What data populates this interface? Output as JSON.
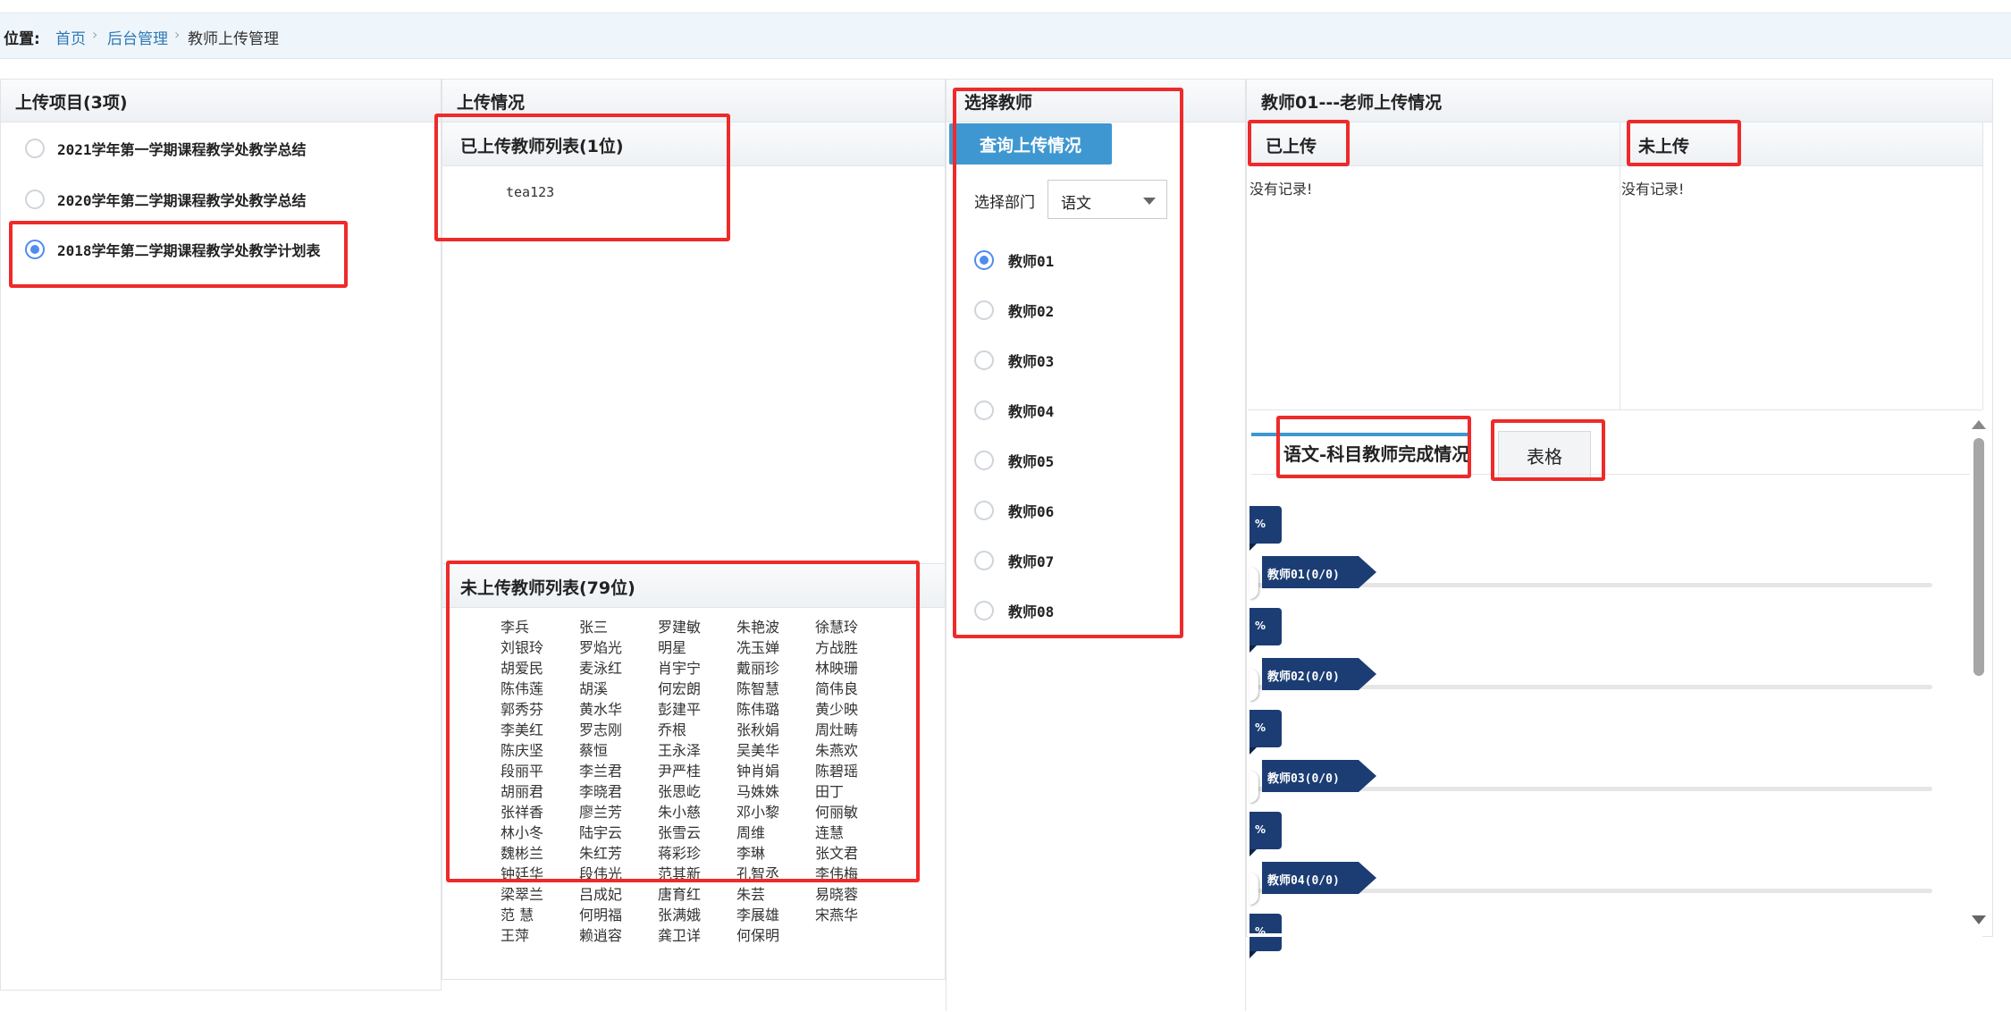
{
  "breadcrumb": {
    "label": "位置:",
    "items": [
      "首页",
      "后台管理",
      "教师上传管理"
    ],
    "separator": "›"
  },
  "projects": {
    "title": "上传项目(3项)",
    "items": [
      {
        "label": "2021学年第一学期课程教学处教学总结",
        "selected": false
      },
      {
        "label": "2020学年第二学期课程教学处教学总结",
        "selected": false
      },
      {
        "label": "2018学年第二学期课程教学处教学计划表",
        "selected": true
      }
    ]
  },
  "upload_status": {
    "title": "上传情况",
    "uploaded_title": "已上传教师列表(1位)",
    "uploaded": [
      "tea123"
    ],
    "not_uploaded_title": "未上传教师列表(79位)",
    "not_uploaded_rows": [
      [
        "李兵",
        "张三",
        "罗建敏",
        "朱艳波",
        "徐慧玲"
      ],
      [
        "刘银玲",
        "罗焰光",
        "明星",
        "冼玉婵",
        "方战胜"
      ],
      [
        "胡爱民",
        "麦泳红",
        "肖宇宁",
        "戴丽珍",
        "林映珊"
      ],
      [
        "陈伟莲",
        "胡溪",
        "何宏朗",
        "陈智慧",
        "简伟良"
      ],
      [
        "郭秀芬",
        "黄水华",
        "彭建平",
        "陈伟璐",
        "黄少映"
      ],
      [
        "李美红",
        "罗志刚",
        "乔根",
        "张秋娟",
        "周灶畴"
      ],
      [
        "陈庆坚",
        "蔡恒",
        "王永泽",
        "吴美华",
        "朱燕欢"
      ],
      [
        "段丽平",
        "李兰君",
        "尹严桂",
        "钟肖娟",
        "陈碧瑶"
      ],
      [
        "胡丽君",
        "李晓君",
        "张思屹",
        "马姝姝",
        "田丁"
      ],
      [
        "张祥香",
        "廖兰芳",
        "朱小慈",
        "邓小黎",
        "何丽敏"
      ],
      [
        "林小冬",
        "陆宇云",
        "张雪云",
        "周维",
        "连慧"
      ],
      [
        "魏彬兰",
        "朱红芳",
        "蒋彩珍",
        "李琳",
        "张文君"
      ],
      [
        "钟廷华",
        "段伟光",
        "范其新",
        "孔智丞",
        "李伟梅"
      ],
      [
        "梁翠兰",
        "吕成妃",
        "唐育红",
        "朱芸",
        "易晓蓉"
      ],
      [
        "范 慧",
        "何明福",
        "张满娥",
        "李展雄",
        "宋燕华"
      ],
      [
        "王萍",
        "赖逍容",
        "龚卫详",
        "何保明"
      ]
    ]
  },
  "select_teacher": {
    "title": "选择教师",
    "query_button": "查询上传情况",
    "dept_label": "选择部门",
    "dept_value": "语文",
    "teachers": [
      {
        "label": "教师01",
        "selected": true
      },
      {
        "label": "教师02",
        "selected": false
      },
      {
        "label": "教师03",
        "selected": false
      },
      {
        "label": "教师04",
        "selected": false
      },
      {
        "label": "教师05",
        "selected": false
      },
      {
        "label": "教师06",
        "selected": false
      },
      {
        "label": "教师07",
        "selected": false
      },
      {
        "label": "教师08",
        "selected": false
      }
    ]
  },
  "teacher_detail": {
    "title": "教师01---老师上传情况",
    "uploaded_title": "已上传",
    "not_uploaded_title": "未上传",
    "empty_text": "没有记录!",
    "tab_completion": "语文-科目教师完成情况",
    "tab_table": "表格",
    "progress": [
      {
        "tag": "%",
        "name": "教师01(0/0)",
        "value": 0
      },
      {
        "tag": "%",
        "name": "教师02(0/0)",
        "value": 0
      },
      {
        "tag": "%",
        "name": "教师03(0/0)",
        "value": 0
      },
      {
        "tag": "%",
        "name": "教师04(0/0)",
        "value": 0
      },
      {
        "tag": "%",
        "name": "",
        "value": 0
      }
    ]
  },
  "colors": {
    "accent_blue": "#3f97d1",
    "progress_navy": "#1c3d74",
    "highlight_red": "#ee2a2a"
  }
}
